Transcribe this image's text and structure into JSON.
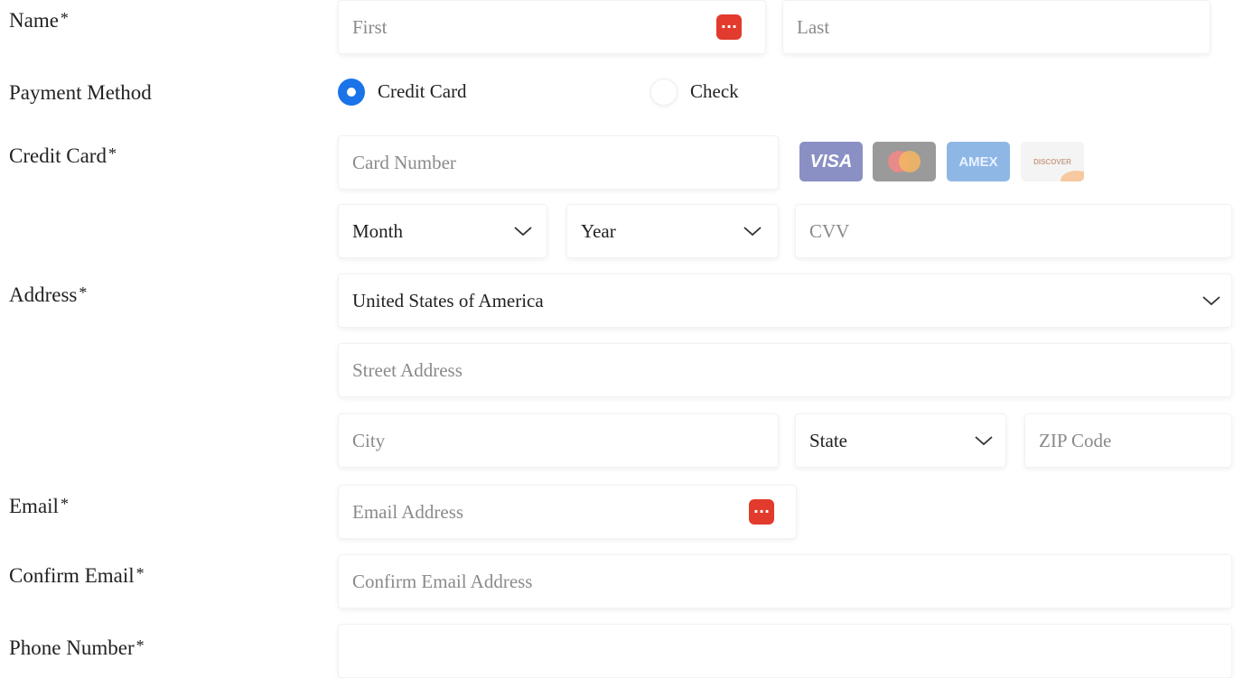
{
  "labels": {
    "name": "Name",
    "payment_method": "Payment Method",
    "credit_card": "Credit Card",
    "address": "Address",
    "email": "Email",
    "confirm_email": "Confirm Email",
    "phone": "Phone Number",
    "required_mark": "*"
  },
  "name": {
    "first_placeholder": "First",
    "last_placeholder": "Last"
  },
  "payment": {
    "options": [
      {
        "label": "Credit Card",
        "selected": true
      },
      {
        "label": "Check",
        "selected": false
      }
    ]
  },
  "card": {
    "number_placeholder": "Card Number",
    "brands": [
      "VISA",
      "mastercard",
      "AMEX",
      "DISCOVER"
    ],
    "month": "Month",
    "year": "Year",
    "cvv_placeholder": "CVV"
  },
  "address": {
    "country": "United States of America",
    "street_placeholder": "Street Address",
    "city_placeholder": "City",
    "state": "State",
    "zip_placeholder": "ZIP Code"
  },
  "email": {
    "email_placeholder": "Email Address",
    "confirm_placeholder": "Confirm Email Address"
  },
  "colors": {
    "accent": "#1a73e8",
    "password_icon": "#e23a2c"
  },
  "icons": {
    "password_manager": "password-manager-icon",
    "dropdown": "chevron-down-icon"
  }
}
